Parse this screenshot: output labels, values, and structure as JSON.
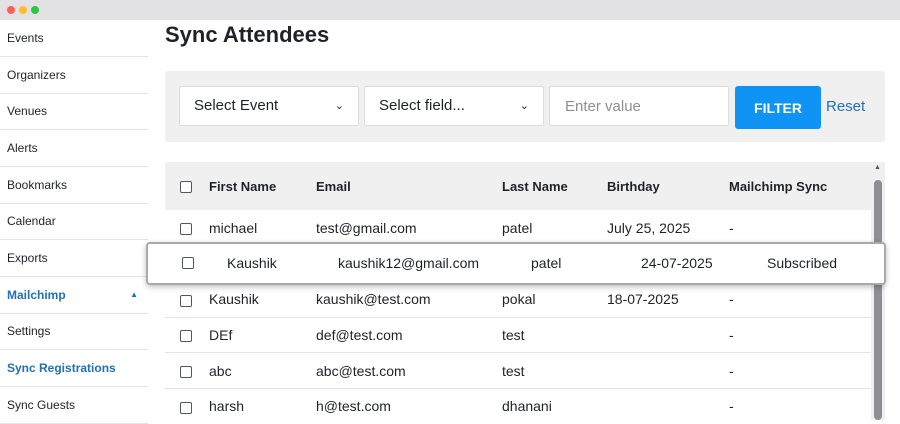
{
  "sidebar": {
    "items": [
      {
        "label": "Events"
      },
      {
        "label": "Organizers"
      },
      {
        "label": "Venues"
      },
      {
        "label": "Alerts"
      },
      {
        "label": "Bookmarks"
      },
      {
        "label": "Calendar"
      },
      {
        "label": "Exports"
      },
      {
        "label": "Mailchimp",
        "active": true,
        "expanded_indicator": "▲"
      },
      {
        "label": "Settings"
      },
      {
        "label": "Sync Registrations",
        "active": true
      },
      {
        "label": "Sync Guests"
      }
    ]
  },
  "page": {
    "title": "Sync Attendees"
  },
  "filter": {
    "event_select": "Select Event",
    "field_select": "Select field...",
    "value_placeholder": "Enter value",
    "filter_button": "FILTER",
    "reset_link": "Reset"
  },
  "table": {
    "headers": [
      "First Name",
      "Email",
      "Last Name",
      "Birthday",
      "Mailchimp Sync"
    ],
    "rows": [
      {
        "first": "michael",
        "email": "test@gmail.com",
        "last": "patel",
        "birthday": "July 25, 2025",
        "sync": "-"
      },
      {
        "first": "Kaushik",
        "email": "kaushik12@gmail.com",
        "last": "patel",
        "birthday": "24-07-2025",
        "sync": "Subscribed"
      },
      {
        "first": "Kaushik",
        "email": "kaushik@test.com",
        "last": "pokal",
        "birthday": "18-07-2025",
        "sync": "-"
      },
      {
        "first": "DEf",
        "email": "def@test.com",
        "last": "test",
        "birthday": "",
        "sync": "-"
      },
      {
        "first": "abc",
        "email": "abc@test.com",
        "last": "test",
        "birthday": "",
        "sync": "-"
      },
      {
        "first": "harsh",
        "email": "h@test.com",
        "last": "dhanani",
        "birthday": "",
        "sync": "-"
      }
    ]
  },
  "colors": {
    "accent": "#2271b1",
    "filter_button": "#0f93f5",
    "header_bg": "#f0f0f1"
  }
}
